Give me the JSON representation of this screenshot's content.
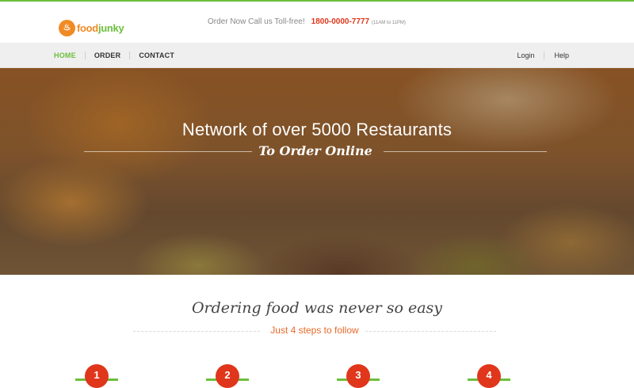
{
  "brand": {
    "logo_part1": "food",
    "logo_part2": "junky",
    "logo_badge": "♨"
  },
  "header": {
    "order_text": "Order Now Call us Toll-free!",
    "phone": "1800-0000-7777",
    "hours": "(11AM to 11PM)"
  },
  "nav": {
    "left": [
      "HOME",
      "ORDER",
      "CONTACT"
    ],
    "right": [
      "Login",
      "Help"
    ],
    "active_index": 0
  },
  "hero": {
    "title": "Network of over 5000 Restaurants",
    "subtitle": "To Order Online"
  },
  "steps_section": {
    "title": "Ordering food was never so easy",
    "subtitle": "Just 4 steps to follow",
    "steps": [
      "1",
      "2",
      "3",
      "4"
    ]
  },
  "colors": {
    "brand_orange": "#f08a24",
    "accent_green": "#6cbf3c",
    "accent_red": "#e0361b",
    "subtitle_orange": "#e8692a"
  }
}
